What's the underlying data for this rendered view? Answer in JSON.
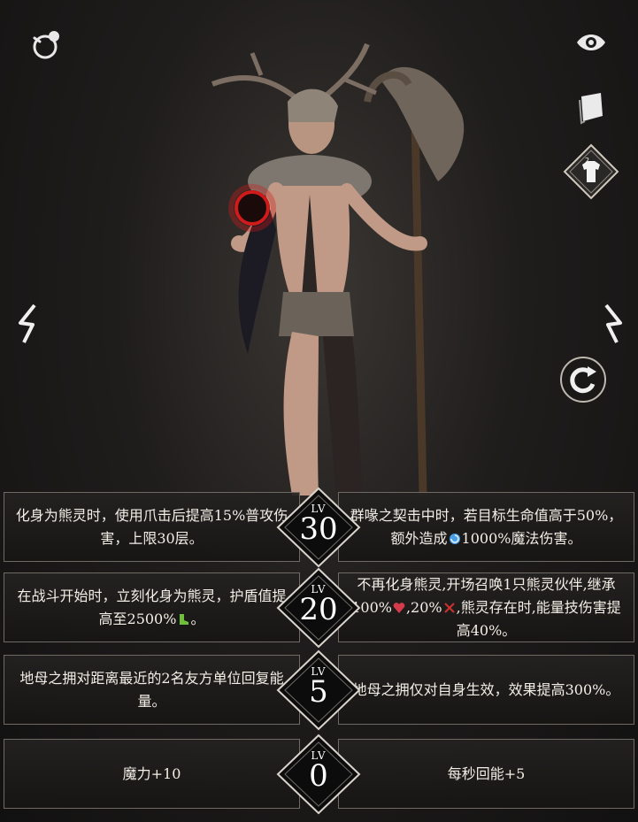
{
  "talents": [
    {
      "level_label": "LV",
      "level": "30",
      "left_text": "化身为熊灵时，使用爪击后提高15%普攻伤害，上限30层。",
      "right_text_parts": [
        "群喙之契击中时，若目标生命值高于50%，额外造成",
        "1000%魔法伤害。"
      ],
      "right_icon": "magic-swirl-icon"
    },
    {
      "level_label": "LV",
      "level": "20",
      "left_text_parts": [
        "在战斗开始时，立刻化身为熊灵，护盾值提高至2500%",
        "。"
      ],
      "left_icon": "shield-boot-icon",
      "right_text_parts": [
        "不再化身熊灵,开场召唤1只熊灵伙伴,继承100%",
        ",20%",
        ",熊灵存在时,能量技伤害提高40%。"
      ],
      "right_icons": [
        "heart-icon",
        "crossed-swords-icon"
      ]
    },
    {
      "level_label": "LV",
      "level": "5",
      "left_text": "地母之拥对距离最近的2名友方单位回复能量。",
      "right_text": "地母之拥仅对自身生效，效果提高300%。"
    },
    {
      "level_label": "LV",
      "level": "0",
      "left_text": "魔力+10",
      "right_text": "每秒回能+5"
    }
  ],
  "colors": {
    "accent_orb": "#d11a1a",
    "magic_icon": "#4a9ee8",
    "heart_icon": "#d43a4a",
    "swords_icon": "#c8322e",
    "boot_icon": "#6fbf3a"
  }
}
